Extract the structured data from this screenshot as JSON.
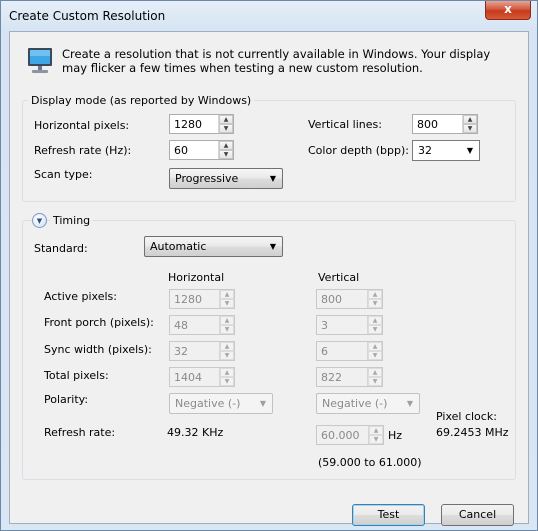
{
  "window": {
    "title": "Create Custom Resolution",
    "close_label": "x"
  },
  "info": {
    "text": "Create a resolution that is not currently available in Windows. Your display may flicker a few times when testing a new custom resolution.",
    "icon": "monitor-icon"
  },
  "display_mode": {
    "title": "Display mode (as reported by Windows)",
    "horizontal_pixels_label": "Horizontal pixels:",
    "horizontal_pixels": "1280",
    "vertical_lines_label": "Vertical lines:",
    "vertical_lines": "800",
    "refresh_rate_label": "Refresh rate (Hz):",
    "refresh_rate": "60",
    "color_depth_label": "Color depth (bpp):",
    "color_depth": "32",
    "scan_type_label": "Scan type:",
    "scan_type": "Progressive"
  },
  "timing": {
    "title": "Timing",
    "standard_label": "Standard:",
    "standard": "Automatic",
    "col_horizontal": "Horizontal",
    "col_vertical": "Vertical",
    "rows": {
      "active": {
        "label": "Active pixels:",
        "h": "1280",
        "v": "800"
      },
      "front_porch": {
        "label": "Front porch (pixels):",
        "h": "48",
        "v": "3"
      },
      "sync_width": {
        "label": "Sync width (pixels):",
        "h": "32",
        "v": "6"
      },
      "total": {
        "label": "Total pixels:",
        "h": "1404",
        "v": "822"
      }
    },
    "polarity_label": "Polarity:",
    "polarity_h": "Negative (-)",
    "polarity_v": "Negative (-)",
    "refresh_label": "Refresh rate:",
    "refresh_h": "49.32 KHz",
    "refresh_v": "60.000",
    "refresh_v_unit": "Hz",
    "refresh_range": "(59.000 to 61.000)",
    "pixel_clock_label": "Pixel clock:",
    "pixel_clock": "69.2453 MHz"
  },
  "buttons": {
    "test": "Test",
    "cancel": "Cancel"
  }
}
